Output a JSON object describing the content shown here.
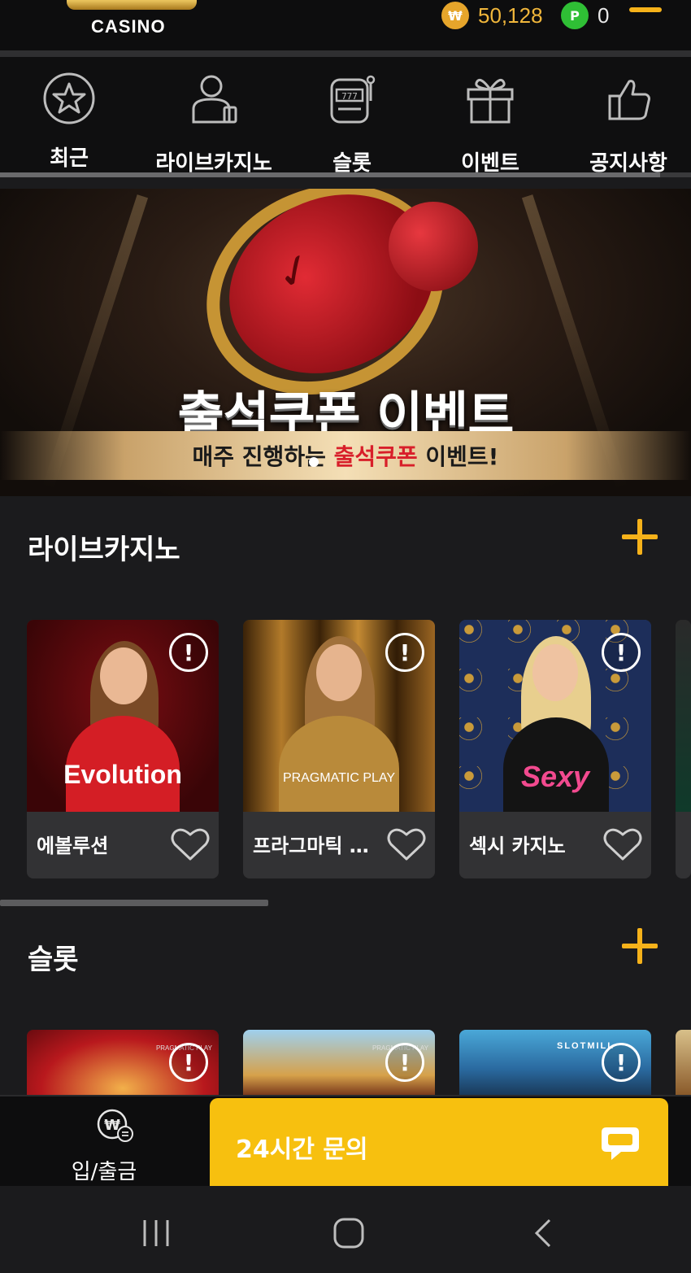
{
  "header": {
    "logo_text": "CASINO",
    "won_symbol": "₩",
    "balance": "50,128",
    "point_symbol": "P",
    "points": "0",
    "menu_icon": "menu-icon"
  },
  "categories": [
    {
      "label": "최근",
      "icon": "star-icon"
    },
    {
      "label": "라이브카지노",
      "icon": "dealer-icon"
    },
    {
      "label": "슬롯",
      "icon": "slot-machine-icon"
    },
    {
      "label": "이벤트",
      "icon": "gift-icon"
    },
    {
      "label": "공지사항",
      "icon": "thumbs-up-icon"
    }
  ],
  "banner": {
    "title": "출석쿠폰 이벤트",
    "subtitle_prefix": "매주 진행하는 ",
    "subtitle_highlight": "출석쿠폰",
    "subtitle_suffix": " 이벤트!"
  },
  "live_casino": {
    "title": "라이브카지노",
    "cards": [
      {
        "name": "에볼루션",
        "provider": "Evolution"
      },
      {
        "name": "프라그마틱 플레이",
        "provider": "PRAGMATIC PLAY"
      },
      {
        "name": "섹시 카지노",
        "provider": "Sexy"
      }
    ]
  },
  "slots": {
    "title": "슬롯",
    "cards": [
      {
        "provider": "PRAGMATIC PLAY"
      },
      {
        "provider": "PRAGMATIC PLAY"
      },
      {
        "provider": "SLOTMILL"
      }
    ]
  },
  "bottom": {
    "deposit_label": "입/출금",
    "inquiry_label": "24시간 문의"
  },
  "colors": {
    "accent": "#f6b21a",
    "inquiry_bg": "#f7c00f",
    "background": "#1b1b1d"
  }
}
